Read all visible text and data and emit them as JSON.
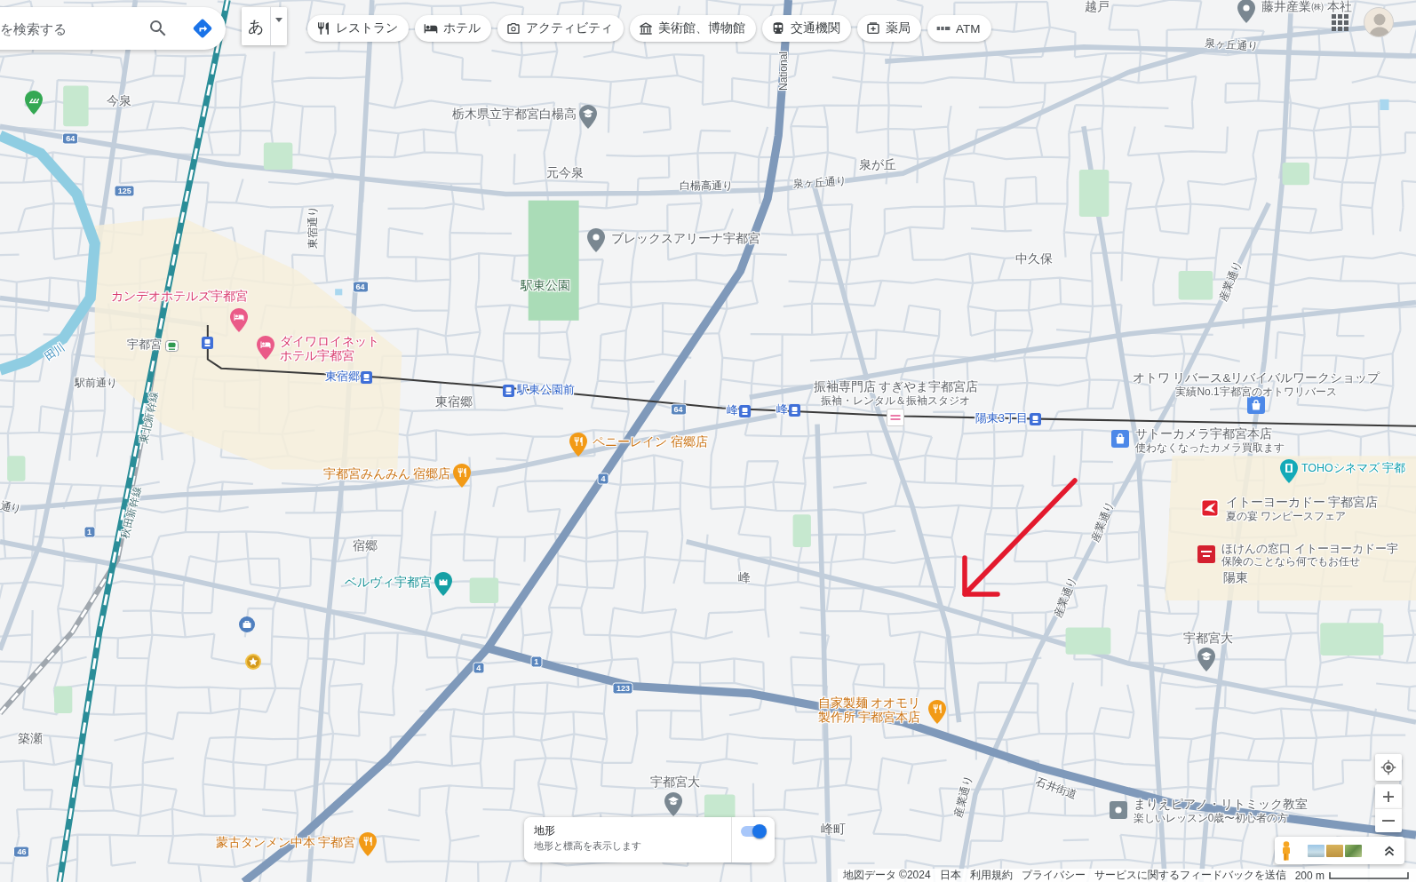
{
  "search": {
    "placeholder": "を検索する"
  },
  "input_tool": {
    "label": "あ"
  },
  "categories": [
    {
      "kind": "restaurant",
      "label": "レストラン"
    },
    {
      "kind": "hotel",
      "label": "ホテル"
    },
    {
      "kind": "activity",
      "label": "アクティビティ"
    },
    {
      "kind": "museum",
      "label": "美術館、博物館"
    },
    {
      "kind": "transit",
      "label": "交通機関"
    },
    {
      "kind": "pharmacy",
      "label": "薬局"
    },
    {
      "kind": "atm",
      "label": "ATM"
    }
  ],
  "map": {
    "labels": [
      {
        "kind": "area",
        "text": "越戸"
      },
      {
        "kind": "road",
        "text": "泉ヶ丘通り"
      },
      {
        "kind": "road",
        "text": "National"
      },
      {
        "kind": "area",
        "text": "今泉"
      },
      {
        "kind": "area",
        "text": "元今泉"
      },
      {
        "kind": "area",
        "text": "泉が丘"
      },
      {
        "kind": "road",
        "text": "白楊高通り"
      },
      {
        "kind": "road",
        "text": "泉ヶ丘通り"
      },
      {
        "kind": "road",
        "text": "東宿通り"
      },
      {
        "kind": "area",
        "text": "中久保"
      },
      {
        "kind": "park",
        "text": "駅東公園"
      },
      {
        "kind": "road",
        "text": "産業通り"
      },
      {
        "kind": "water",
        "text": "田川"
      },
      {
        "kind": "road",
        "text": "駅前通り"
      },
      {
        "kind": "rail",
        "text": "東北新幹線"
      },
      {
        "kind": "area",
        "text": "東宿郷"
      },
      {
        "kind": "road",
        "text": "通り"
      },
      {
        "kind": "rail",
        "text": "秋田新幹線"
      },
      {
        "kind": "area",
        "text": "宿郷"
      },
      {
        "kind": "road",
        "text": "産業通り"
      },
      {
        "kind": "area",
        "text": "峰"
      },
      {
        "kind": "road",
        "text": "産業通り"
      },
      {
        "kind": "area",
        "text": "陽東"
      },
      {
        "kind": "area",
        "text": "築瀬"
      },
      {
        "kind": "road",
        "text": "産業通り"
      },
      {
        "kind": "road",
        "text": "石井街道"
      },
      {
        "kind": "area",
        "text": "峰町"
      }
    ],
    "places": [
      {
        "kind": "company",
        "name": "藤井産業㈱ 本社"
      },
      {
        "kind": "school",
        "name": "栃木県立宇都宮白楊高"
      },
      {
        "kind": "venue",
        "name": "ブレックスアリーナ宇都宮"
      },
      {
        "kind": "hotel",
        "name": "カンデオホテルズ宇都宮"
      },
      {
        "kind": "hotel",
        "name": "ダイワロイネットホテル宇都宮"
      },
      {
        "kind": "kimono",
        "name": "振袖専門店 すぎやま宇都宮店",
        "note": "振袖・レンタル＆振袖スタジオ"
      },
      {
        "kind": "shop",
        "name": "オトワ リバース&リバイバルワークショップ",
        "note": "実績No.1宇都宮のオトワリバース"
      },
      {
        "kind": "restaurant",
        "name": "ペニーレイン 宿郷店"
      },
      {
        "kind": "shop",
        "name": "サトーカメラ宇都宮本店",
        "note": "使わなくなったカメラ買取ます"
      },
      {
        "kind": "restaurant",
        "name": "宇都宮みんみん 宿郷店"
      },
      {
        "kind": "cinema",
        "name": "TOHOシネマズ 宇都"
      },
      {
        "kind": "supermarket",
        "name": "イトーヨーカドー 宇都宮店",
        "note": "夏の宴 ワンピースフェア"
      },
      {
        "kind": "insurance",
        "name": "ほけんの窓口 イトーヨーカドー宇",
        "note": "保険のことなら何でもお任せ"
      },
      {
        "kind": "landmark",
        "name": "ベルヴィ宇都宮"
      },
      {
        "kind": "school",
        "name": "宇都宮大"
      },
      {
        "kind": "restaurant",
        "name": "自家製麺 オオモリ製作所 宇都宮本店"
      },
      {
        "kind": "school",
        "name": "宇都宮大"
      },
      {
        "kind": "music",
        "name": "まりえピアノ・リトミック教室",
        "note": "楽しいレッスン0歳〜初心者の方"
      },
      {
        "kind": "restaurant",
        "name": "蒙古タンメン中本 宇都宮"
      }
    ],
    "stations": [
      {
        "kind": "rail",
        "name": "宇都宮"
      },
      {
        "kind": "tram",
        "name": "東宿郷"
      },
      {
        "kind": "tram",
        "name": "駅東公園前"
      },
      {
        "kind": "tram",
        "name": "峰"
      },
      {
        "kind": "tram",
        "name": "峰"
      },
      {
        "kind": "tram",
        "name": "陽東3丁目"
      }
    ],
    "route_shields": [
      "64",
      "125",
      "64",
      "64",
      "4",
      "1",
      "4",
      "1",
      "123",
      "46"
    ]
  },
  "layer_card": {
    "title": "地形",
    "description": "地形と標高を表示します",
    "on": true
  },
  "footer": {
    "links": [
      "地図データ ©2024",
      "日本",
      "利用規約",
      "プライバシー",
      "サービスに関するフィードバックを送信"
    ],
    "scale": "200 m"
  }
}
